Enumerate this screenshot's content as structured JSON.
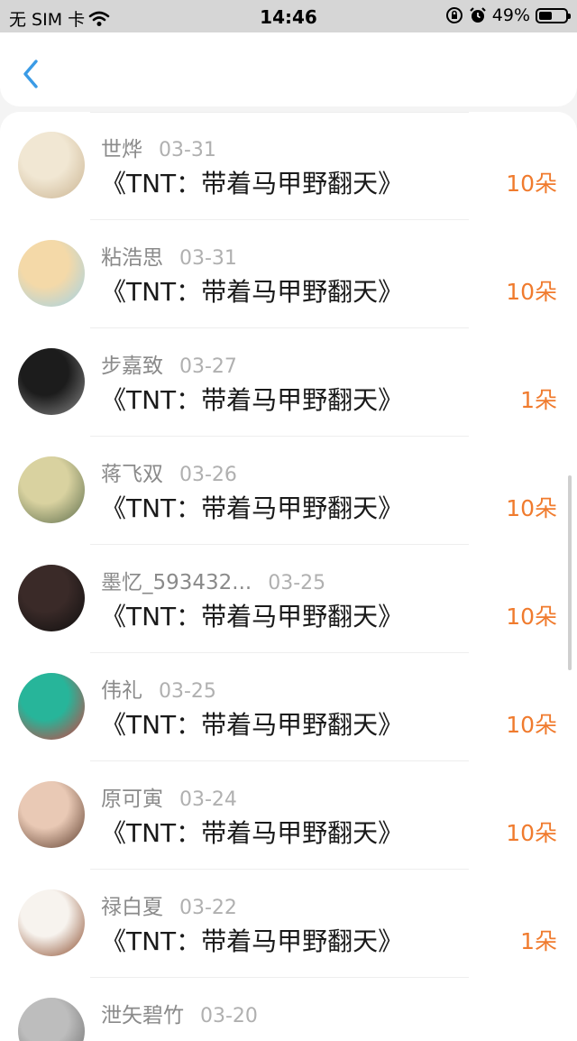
{
  "status_bar": {
    "carrier": "无 SIM 卡",
    "time": "14:46",
    "battery": "49%",
    "battery_level": 0.49
  },
  "nav": {
    "back_icon": "chevron-left-icon",
    "accent": "#3a9be6"
  },
  "accent_count_color": "#f07b2e",
  "gifts": [
    {
      "name": "世烨",
      "date": "03-31",
      "book": "《TNT：带着马甲野翻天》",
      "count": "10朵",
      "avatar_colors": [
        "#f1e7d3",
        "#c9b28f"
      ]
    },
    {
      "name": "粘浩思",
      "date": "03-31",
      "book": "《TNT：带着马甲野翻天》",
      "count": "10朵",
      "avatar_colors": [
        "#f4d9a8",
        "#9fd2e8"
      ]
    },
    {
      "name": "步嘉致",
      "date": "03-27",
      "book": "《TNT：带着马甲野翻天》",
      "count": "1朵",
      "avatar_colors": [
        "#1c1c1c",
        "#8a8a8a"
      ]
    },
    {
      "name": "蒋飞双",
      "date": "03-26",
      "book": "《TNT：带着马甲野翻天》",
      "count": "10朵",
      "avatar_colors": [
        "#d9d2a0",
        "#5a6b4a"
      ]
    },
    {
      "name": "墨忆_593432...",
      "date": "03-25",
      "book": "《TNT：带着马甲野翻天》",
      "count": "10朵",
      "avatar_colors": [
        "#3a2a28",
        "#0e0e0e"
      ]
    },
    {
      "name": "伟礼",
      "date": "03-25",
      "book": "《TNT：带着马甲野翻天》",
      "count": "10朵",
      "avatar_colors": [
        "#27b59a",
        "#d93a3a"
      ]
    },
    {
      "name": "原可寅",
      "date": "03-24",
      "book": "《TNT：带着马甲野翻天》",
      "count": "10朵",
      "avatar_colors": [
        "#e9c9b5",
        "#5a3a2a"
      ]
    },
    {
      "name": "禄白夏",
      "date": "03-22",
      "book": "《TNT：带着马甲野翻天》",
      "count": "1朵",
      "avatar_colors": [
        "#f7f3ee",
        "#8a4a2a"
      ]
    },
    {
      "name": "泄矢碧竹",
      "date": "03-20",
      "book": "",
      "count": "",
      "avatar_colors": [
        "#bdbdbd",
        "#6b6b6b"
      ]
    }
  ]
}
